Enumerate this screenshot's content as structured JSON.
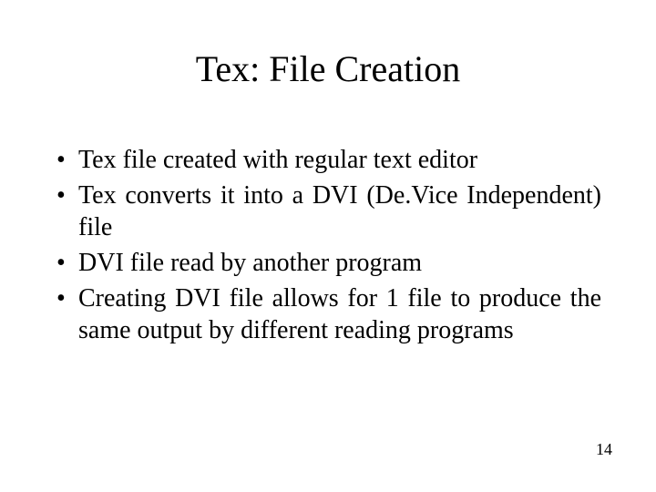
{
  "title": "Tex: File Creation",
  "bullets": [
    "Tex file created with regular text editor",
    "Tex converts it into a DVI (De.Vice Independent) file",
    "DVI file read by another program",
    "Creating DVI file allows for 1 file to produce the same output by different reading programs"
  ],
  "page_number": "14"
}
